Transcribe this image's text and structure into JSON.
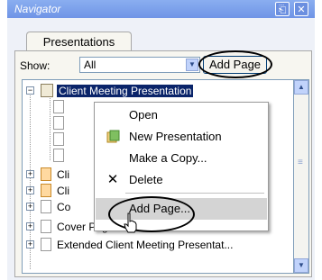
{
  "window": {
    "title": "Navigator",
    "pin_icon": "pin-icon",
    "close_icon": "close-icon"
  },
  "tabs": [
    {
      "label": "Presentations"
    }
  ],
  "filter": {
    "label": "Show:",
    "value": "All",
    "add_page_label": "Add Page"
  },
  "tree": {
    "rows": [
      {
        "label": "Client Meeting Presentation",
        "selected": true,
        "icon": "book-icon"
      },
      {
        "label": "",
        "icon": "page-icon"
      },
      {
        "label": "",
        "icon": "page-icon"
      },
      {
        "label": "",
        "icon": "page-icon"
      },
      {
        "label": "",
        "icon": "page-icon"
      },
      {
        "label": "Cli",
        "icon": "orange-page-icon"
      },
      {
        "label": "Cli",
        "icon": "orange-page-icon"
      },
      {
        "label": "Co",
        "icon": "page-icon"
      },
      {
        "label": "Cover Page and Overview",
        "icon": "page-icon"
      },
      {
        "label": "Extended Client Meeting Presentat...",
        "icon": "page-icon"
      }
    ]
  },
  "context_menu": {
    "items": [
      {
        "label": "Open",
        "icon": ""
      },
      {
        "label": "New Presentation",
        "icon": "new-presentation-icon"
      },
      {
        "label": "Make a Copy...",
        "icon": ""
      },
      {
        "label": "Delete",
        "icon": "delete-x-icon"
      },
      {
        "label": "Add Page...",
        "icon": "",
        "hovered": true
      }
    ]
  },
  "colors": {
    "selection": "#0a246a",
    "titlebar": "#7a9ceb",
    "panel": "#f7f6f0"
  }
}
